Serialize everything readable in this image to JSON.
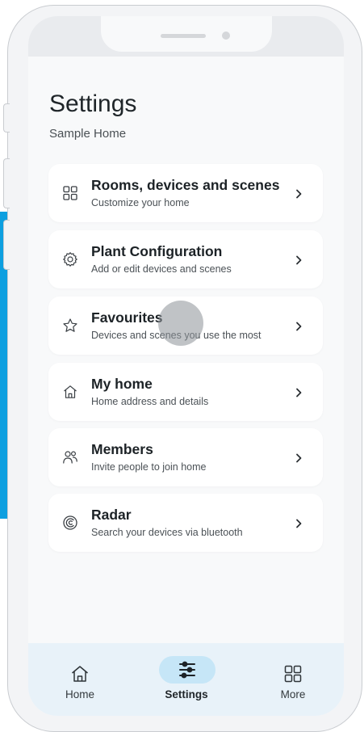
{
  "page": {
    "title": "Settings",
    "home_name": "Sample Home"
  },
  "settings_items": [
    {
      "title": "Rooms, devices and scenes",
      "subtitle": "Customize your home",
      "icon": "grid-icon"
    },
    {
      "title": "Plant Configuration",
      "subtitle": "Add or edit devices and scenes",
      "icon": "gear-icon"
    },
    {
      "title": "Favourites",
      "subtitle": "Devices and scenes you use the most",
      "icon": "star-icon"
    },
    {
      "title": "My home",
      "subtitle": "Home address and details",
      "icon": "house-icon"
    },
    {
      "title": "Members",
      "subtitle": "Invite people to join home",
      "icon": "people-icon"
    },
    {
      "title": "Radar",
      "subtitle": "Search your devices via bluetooth",
      "icon": "radar-icon"
    }
  ],
  "bottom_nav": {
    "items": [
      {
        "label": "Home",
        "icon": "house-icon"
      },
      {
        "label": "Settings",
        "icon": "sliders-icon",
        "active": true
      },
      {
        "label": "More",
        "icon": "grid-icon"
      }
    ]
  },
  "colors": {
    "background": "#f8f9fa",
    "card": "#ffffff",
    "nav_background": "#e8f2f9",
    "active_pill": "#c6e6f7",
    "accent_band": "#0d9fe0",
    "text_primary": "#1f2529"
  }
}
